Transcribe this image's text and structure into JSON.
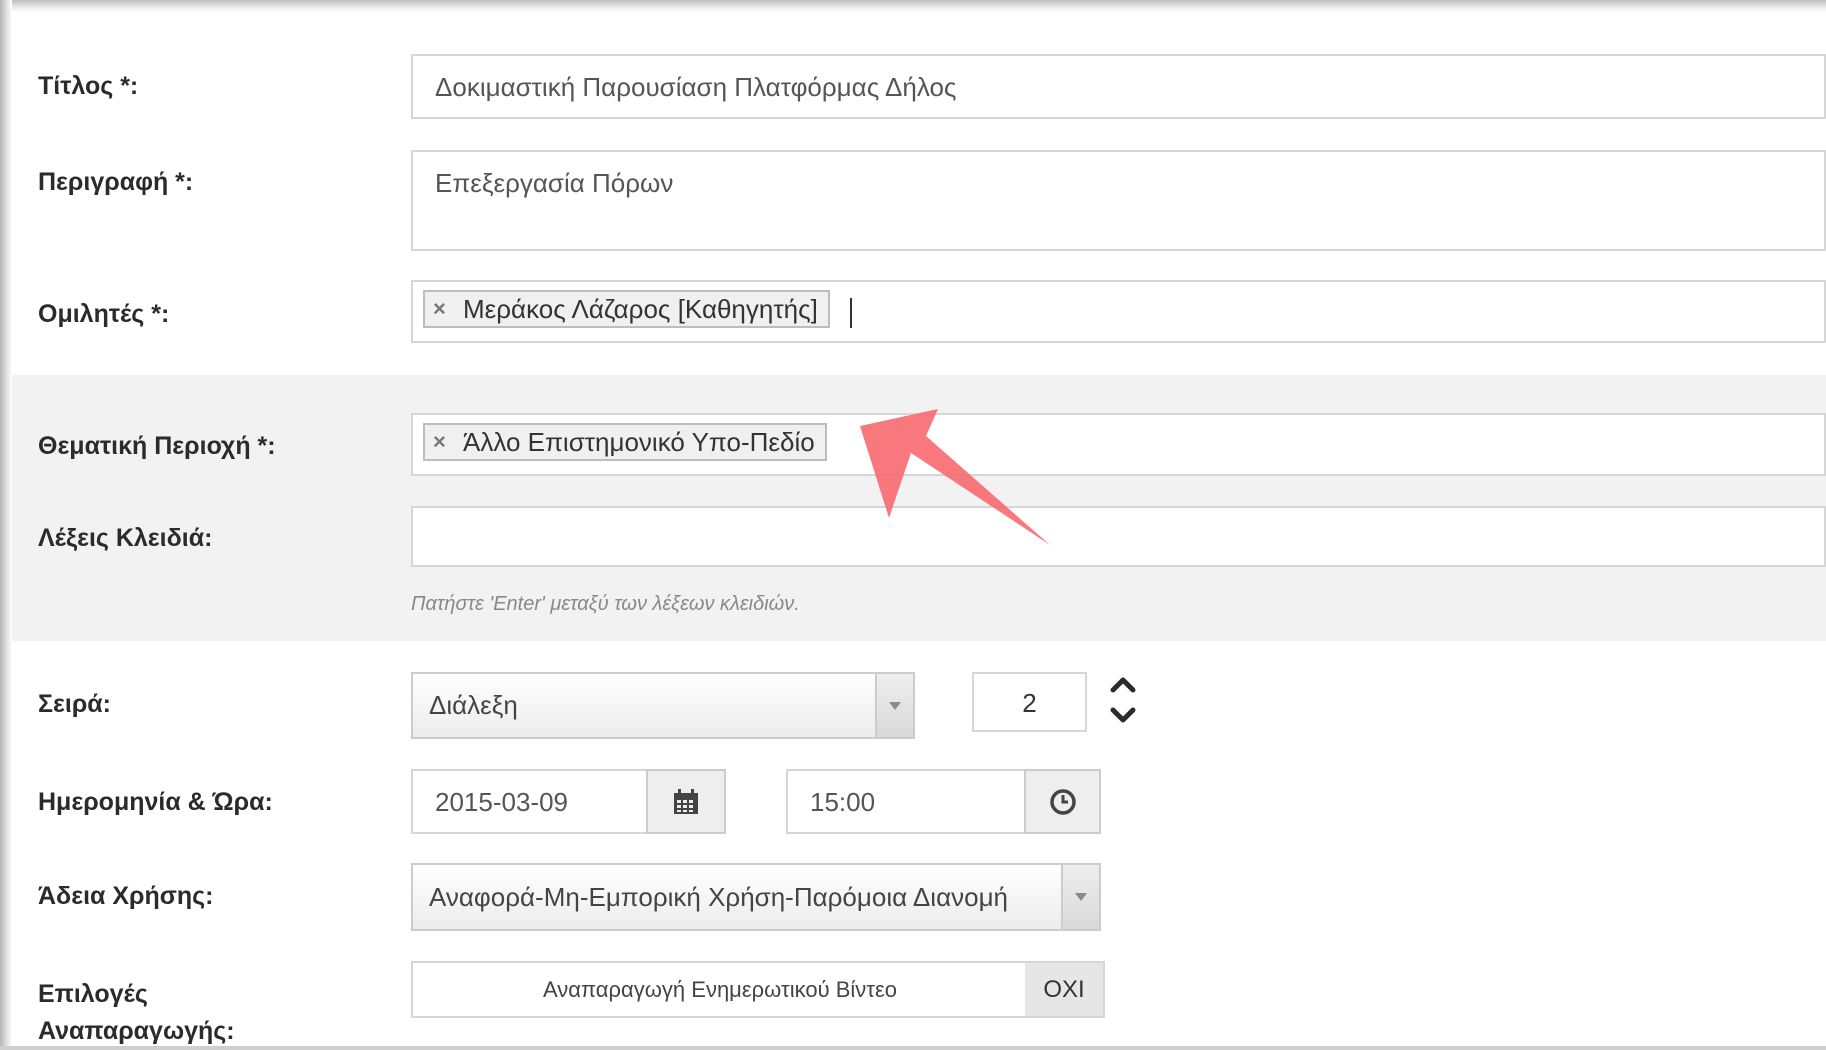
{
  "form": {
    "title": {
      "label": "Τίτλος *:",
      "value": "Δοκιμαστική Παρουσίαση Πλατφόρμας Δήλος"
    },
    "description": {
      "label": "Περιγραφή *:",
      "value": "Επεξεργασία Πόρων"
    },
    "speakers": {
      "label": "Ομιλητές *:",
      "tags": [
        "Μεράκος Λάζαρος [Καθηγητής]"
      ]
    },
    "subject_area": {
      "label": "Θεματική Περιοχή *:",
      "tags": [
        "Άλλο Επιστημονικό Υπο-Πεδίο"
      ]
    },
    "keywords": {
      "label": "Λέξεις Κλειδιά:",
      "value": "",
      "hint": "Πατήστε 'Enter' μεταξύ των λέξεων κλειδιών."
    },
    "series": {
      "label": "Σειρά:",
      "selected": "Διάλεξη",
      "number": "2"
    },
    "datetime": {
      "label": "Ημερομηνία & Ώρα:",
      "date": "2015-03-09",
      "time": "15:00"
    },
    "license": {
      "label": "Άδεια Χρήσης:",
      "selected": "Αναφορά-Μη-Εμπορική Χρήση-Παρόμοια Διανομή"
    },
    "playback": {
      "label_line1": "Επιλογές",
      "label_line2": "Αναπαραγωγής:",
      "option_label": "Αναπαραγωγή Ενημερωτικού Βίντεο",
      "option_state": "ΟΧΙ"
    }
  },
  "icons": {
    "tag_remove": "×",
    "calendar": "calendar-icon",
    "clock": "clock-icon",
    "spinner": "chevron-up-down-icon",
    "dropdown": "caret-down-icon"
  },
  "colors": {
    "panel_bg": "#f2f2f2",
    "highlight_arrow": "#f76e74"
  }
}
